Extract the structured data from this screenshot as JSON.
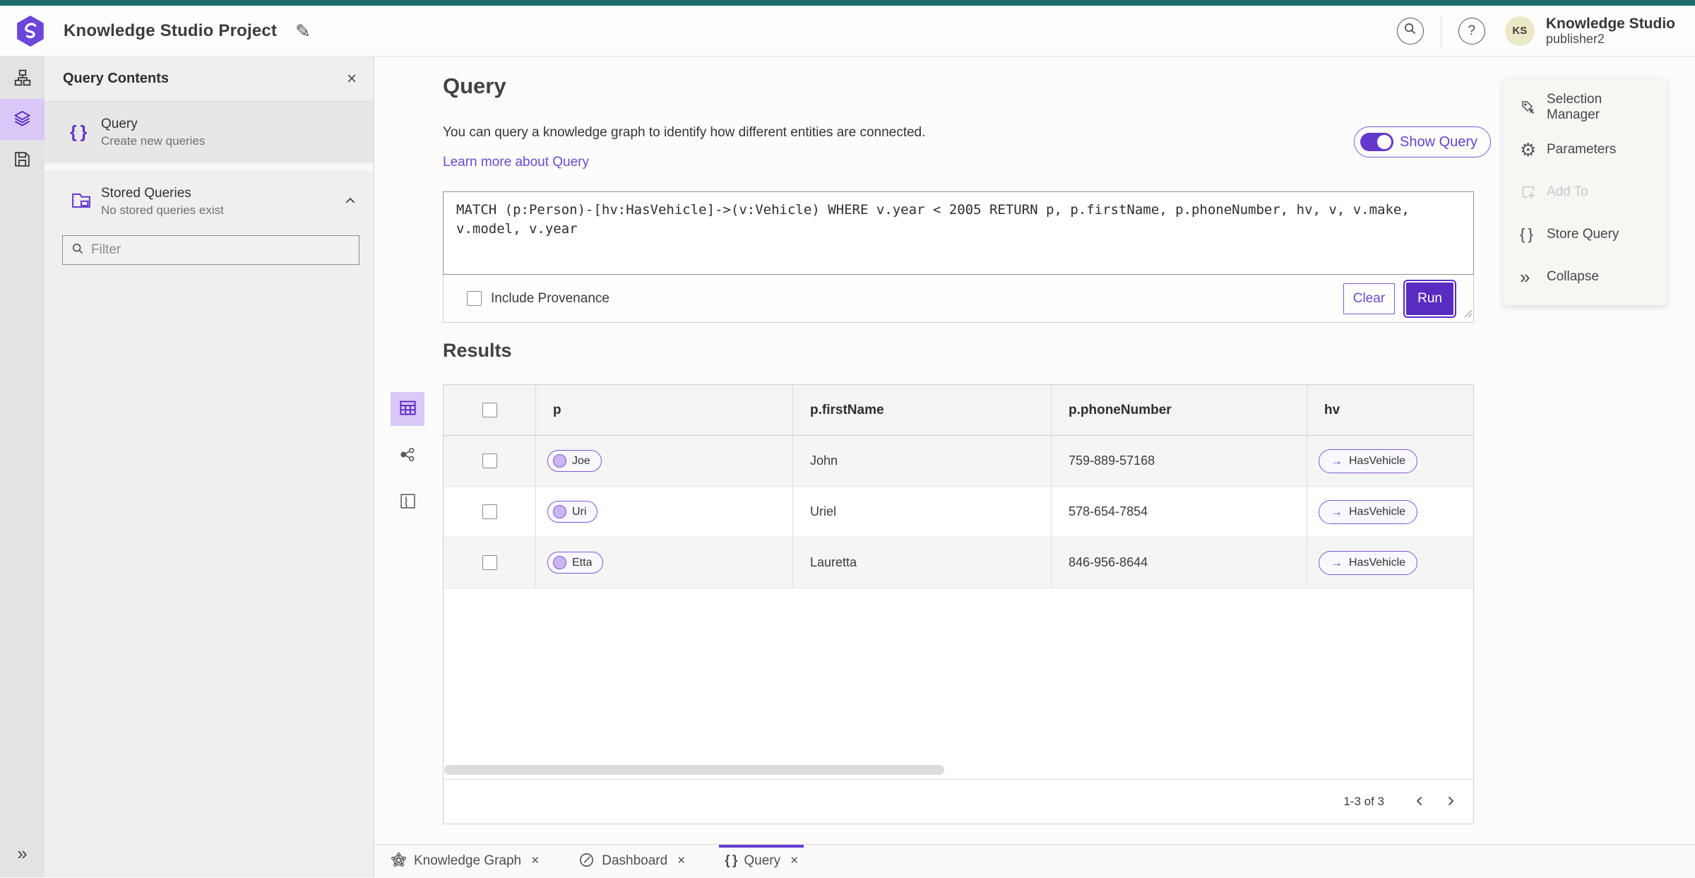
{
  "colors": {
    "accent": "#6a3dd1",
    "accent_deep": "#5a2bc0",
    "accent_light": "#d9c8f8",
    "top_strip": "#1e6b6b"
  },
  "icons": {
    "edit": "✎",
    "help": "?",
    "close": "×",
    "braces": "{ }",
    "collapse": "»",
    "expand": "»",
    "gear": "⚙",
    "arrow_right": "→"
  },
  "header": {
    "app_title": "Knowledge Studio Project",
    "user_initials": "KS",
    "user_name": "Knowledge Studio",
    "user_role": "publisher2"
  },
  "contents_panel": {
    "title": "Query Contents",
    "query_item": {
      "label": "Query",
      "sub": "Create new queries"
    },
    "stored_item": {
      "label": "Stored Queries",
      "sub": "No stored queries exist"
    },
    "filter_placeholder": "Filter"
  },
  "query_section": {
    "title": "Query",
    "description": "You can query a knowledge graph to identify how different entities are connected.",
    "learn_more": "Learn more about Query",
    "show_query": "Show Query",
    "query_text": "MATCH (p:Person)-[hv:HasVehicle]->(v:Vehicle) WHERE v.year < 2005 RETURN p, p.firstName, p.phoneNumber, hv, v, v.make, v.model, v.year",
    "include_provenance": "Include Provenance",
    "clear": "Clear",
    "run": "Run"
  },
  "results": {
    "title": "Results",
    "columns": [
      "p",
      "p.firstName",
      "p.phoneNumber",
      "hv"
    ],
    "rows": [
      {
        "p": "Joe",
        "firstName": "John",
        "phone": "759-889-57168",
        "hv": "HasVehicle"
      },
      {
        "p": "Uri",
        "firstName": "Uriel",
        "phone": "578-654-7854",
        "hv": "HasVehicle"
      },
      {
        "p": "Etta",
        "firstName": "Lauretta",
        "phone": "846-956-8644",
        "hv": "HasVehicle"
      }
    ],
    "pagination": "1-3 of 3"
  },
  "right_panel": {
    "selection_manager": "Selection Manager",
    "parameters": "Parameters",
    "add_to": "Add To",
    "store_query": "Store Query",
    "collapse": "Collapse"
  },
  "tabs": [
    {
      "label": "Knowledge Graph"
    },
    {
      "label": "Dashboard"
    },
    {
      "label": "Query"
    }
  ]
}
